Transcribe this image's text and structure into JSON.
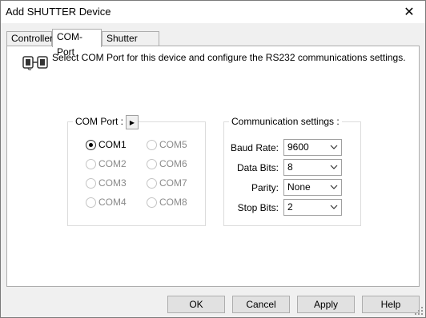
{
  "window": {
    "title": "Add SHUTTER Device",
    "close_glyph": "✕"
  },
  "tabs": [
    {
      "label": "Controller",
      "active": false
    },
    {
      "label": "COM-Port",
      "active": true
    },
    {
      "label": "Shutter Setup",
      "active": false
    }
  ],
  "info": {
    "icon": "serial-connector-icon",
    "text": "Select COM Port for this device and configure the RS232 communications settings."
  },
  "com_port": {
    "title": "COM Port :",
    "arrow_glyph": "▶",
    "selected": "COM1",
    "ports": [
      "COM1",
      "COM2",
      "COM3",
      "COM4",
      "COM5",
      "COM6",
      "COM7",
      "COM8"
    ]
  },
  "comm": {
    "title": "Communication settings :",
    "baud_label": "Baud Rate:",
    "baud_value": "9600",
    "data_label": "Data Bits:",
    "data_value": "8",
    "parity_label": "Parity:",
    "parity_value": "None",
    "stop_label": "Stop Bits:",
    "stop_value": "2"
  },
  "buttons": {
    "ok": "OK",
    "cancel": "Cancel",
    "apply": "Apply",
    "help": "Help"
  }
}
